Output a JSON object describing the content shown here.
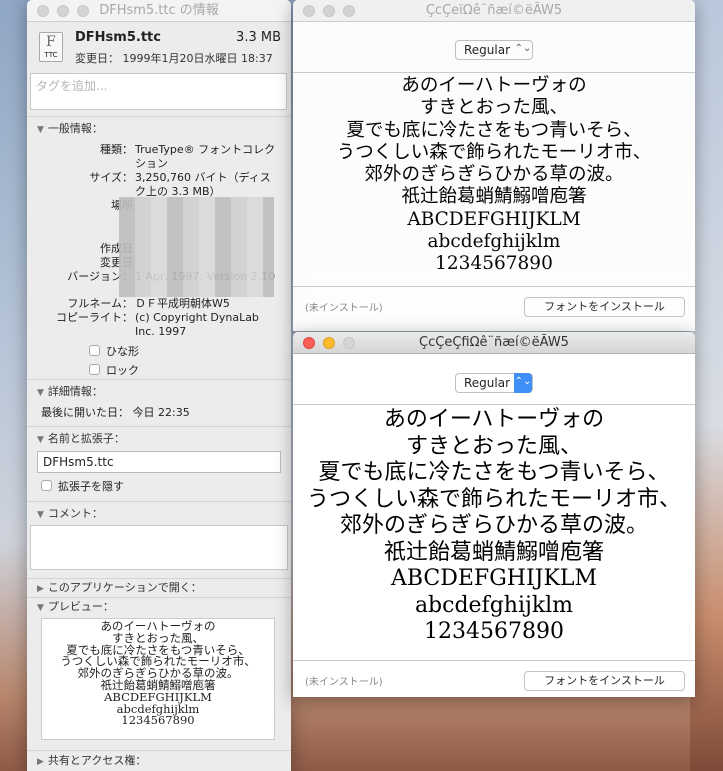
{
  "info": {
    "title": "DFHsm5.ttc の情報",
    "icon_label": "TTC",
    "filename": "DFHsm5.ttc",
    "size": "3.3 MB",
    "modified_label": "変更日：",
    "modified": "1999年1月20日水曜日 18:37",
    "tags_placeholder": "タグを追加...",
    "general": {
      "header": "一般情報：",
      "rows": [
        {
          "k": "種類：",
          "v": "TrueType® フォントコレクション"
        },
        {
          "k": "サイズ：",
          "v": "3,250,760 バイト（ディスク上の 3.3 MB）"
        },
        {
          "k": "場所",
          "v": ""
        },
        {
          "k": "",
          "v": ""
        },
        {
          "k": "作成日",
          "v": ""
        },
        {
          "k": "変更日",
          "v": ""
        },
        {
          "k": "バージョン：",
          "v": "1 Apr, 1997: Version 2.10"
        },
        {
          "k": "フルネーム：",
          "v": "ＤＦ平成明朝体W5"
        },
        {
          "k": "コピーライト：",
          "v": "(c) Copyright DynaLab Inc. 1997"
        }
      ],
      "stationery": "ひな形",
      "locked": "ロック"
    },
    "more": {
      "header": "詳細情報：",
      "last_opened_label": "最後に開いた日：",
      "last_opened": "今日 22:35"
    },
    "name_ext": {
      "header": "名前と拡張子：",
      "value": "DFHsm5.ttc",
      "hide_ext": "拡張子を隠す"
    },
    "comments": {
      "header": "コメント："
    },
    "open_with": {
      "header": "このアプリケーションで開く："
    },
    "preview": {
      "header": "プレビュー："
    },
    "sharing": {
      "header": "共有とアクセス権："
    }
  },
  "sample_lines": [
    "あのイーハトーヴォの",
    "すきとおった風、",
    "夏でも底に冷たさをもつ青いそら、",
    "うつくしい森で飾られたモーリオ市、",
    "郊外のぎらぎらひかる草の波。",
    "祇辻飴葛蛸鯖鰯噌庖箸",
    "ABCDEFGHIJKLM",
    "abcdefghijklm",
    "1234567890"
  ],
  "font_window_1": {
    "title": "ÇcÇeïΩê¨ñæí©ëÃW5",
    "style": "Regular",
    "status": "(未インストール)",
    "install": "フォントをインストール"
  },
  "font_window_2": {
    "title": "ÇcÇeÇfiΩê¨ñæí©ëÃW5",
    "style": "Regular",
    "status": "(未インストール)",
    "install": "フォントをインストール"
  }
}
